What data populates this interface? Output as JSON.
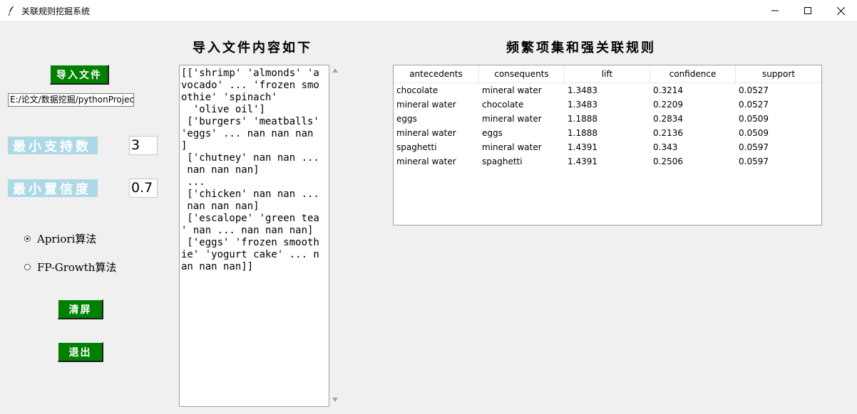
{
  "window": {
    "title": "关联规则挖掘系统",
    "controls": [
      "minimize-icon",
      "maximize-icon",
      "close-icon"
    ]
  },
  "headings": {
    "file_content": "导入文件内容如下",
    "rules": "频繁项集和强关联规则"
  },
  "left_panel": {
    "import_button": "导入文件",
    "file_path": "E:/论文/数据挖掘/pythonProjec",
    "min_support_label": "最小支持数",
    "min_support_value": "3",
    "min_confidence_label": "最小置信度",
    "min_confidence_value": "0.7",
    "algorithms": [
      {
        "label": "Apriori算法",
        "selected": true
      },
      {
        "label": "FP-Growth算法",
        "selected": false
      }
    ],
    "clear_button": "清屏",
    "exit_button": "退出"
  },
  "file_content_text": "[['shrimp' 'almonds' 'a\nvocado' ... 'frozen smo\nothie' 'spinach'\n  'olive oil']\n ['burgers' 'meatballs'\n'eggs' ... nan nan nan\n]\n ['chutney' nan nan ...\n nan nan nan]\n ...\n ['chicken' nan nan ...\n nan nan nan]\n ['escalope' 'green tea\n' nan ... nan nan nan]\n ['eggs' 'frozen smooth\nie' 'yogurt cake' ... n\nan nan nan]]",
  "rules_table": {
    "columns": [
      "antecedents",
      "consequents",
      "lift",
      "confidence",
      "support"
    ],
    "rows": [
      [
        "chocolate",
        "mineral water",
        "1.3483",
        "0.3214",
        "0.0527"
      ],
      [
        "mineral water",
        "chocolate",
        "1.3483",
        "0.2209",
        "0.0527"
      ],
      [
        "eggs",
        "mineral water",
        "1.1888",
        "0.2834",
        "0.0509"
      ],
      [
        "mineral water",
        "eggs",
        "1.1888",
        "0.2136",
        "0.0509"
      ],
      [
        "spaghetti",
        "mineral water",
        "1.4391",
        "0.343",
        "0.0597"
      ],
      [
        "mineral water",
        "spaghetti",
        "1.4391",
        "0.2506",
        "0.0597"
      ]
    ]
  },
  "colors": {
    "button_bg": "#008000",
    "label_bg": "#add8e6",
    "window_bg": "#f0f0f0"
  }
}
